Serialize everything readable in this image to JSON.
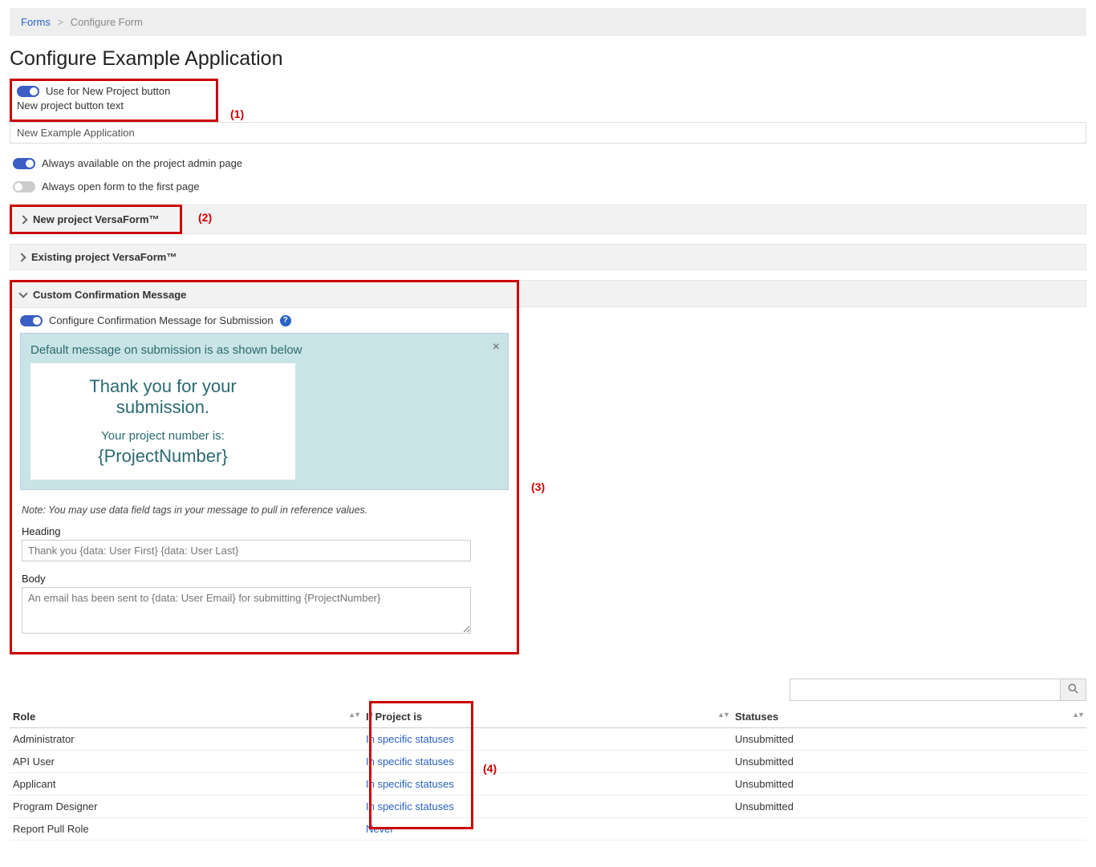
{
  "breadcrumb": {
    "link": "Forms",
    "current": "Configure Form"
  },
  "page_title": "Configure Example Application",
  "annotations": {
    "a1": "(1)",
    "a2": "(2)",
    "a3": "(3)",
    "a4": "(4)"
  },
  "toggle1": {
    "label": "Use for New Project button"
  },
  "button_text_label": "New project button text",
  "button_text_value": "New Example Application",
  "toggle2": {
    "label": "Always available on the project admin page"
  },
  "toggle3": {
    "label": "Always open form to the first page"
  },
  "accordion": {
    "new_vf": "New project VersaForm™",
    "existing_vf": "Existing project VersaForm™",
    "custom_msg": "Custom Confirmation Message"
  },
  "confirm_toggle": "Configure Confirmation Message for Submission",
  "preview": {
    "hint": "Default message on submission is as shown below",
    "thank": "Thank you for your submission.",
    "pn_label": "Your project number is:",
    "pn_value": "{ProjectNumber}"
  },
  "note": "Note: You may use data field tags in your message to pull in reference values.",
  "heading_field": {
    "label": "Heading",
    "placeholder": "Thank you {data: User First} {data: User Last}"
  },
  "body_field": {
    "label": "Body",
    "placeholder": "An email has been sent to {data: User Email} for submitting {ProjectNumber}"
  },
  "table": {
    "headers": {
      "role": "Role",
      "if": "If Project is",
      "statuses": "Statuses"
    },
    "rows": [
      {
        "role": "Administrator",
        "if": "In specific statuses",
        "statuses": "Unsubmitted"
      },
      {
        "role": "API User",
        "if": "In specific statuses",
        "statuses": "Unsubmitted"
      },
      {
        "role": "Applicant",
        "if": "In specific statuses",
        "statuses": "Unsubmitted"
      },
      {
        "role": "Program Designer",
        "if": "In specific statuses",
        "statuses": "Unsubmitted"
      },
      {
        "role": "Report Pull Role",
        "if": "Never",
        "statuses": ""
      }
    ]
  }
}
